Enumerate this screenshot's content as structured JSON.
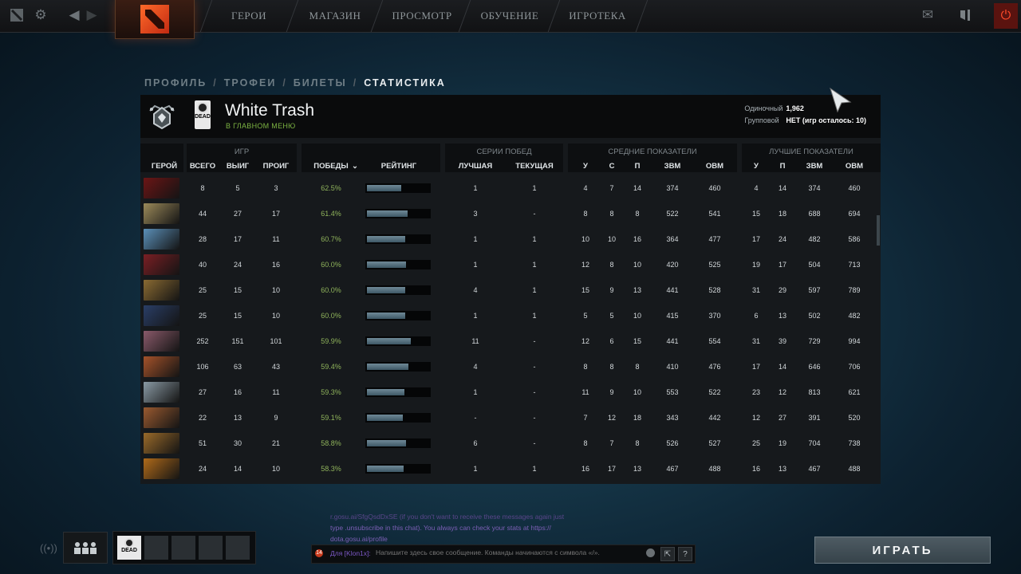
{
  "topbar": {
    "nav": [
      "ГЕРОИ",
      "МАГАЗИН",
      "ПРОСМОТР",
      "ОБУЧЕНИЕ",
      "ИГРОТЕКА"
    ]
  },
  "breadcrumb": [
    "ПРОФИЛЬ",
    "ТРОФЕИ",
    "БИЛЕТЫ",
    "СТАТИСТИКА"
  ],
  "profile": {
    "avatar_text": "DEAD",
    "name": "White Trash",
    "status": "В ГЛАВНОМ МЕНЮ",
    "rank_solo_label": "Одиночный",
    "rank_solo_value": "1,962",
    "rank_party_label": "Групповой",
    "rank_party_value": "НЕТ (игр осталось: 10)"
  },
  "table": {
    "groups": {
      "games": "ИГР",
      "streaks": "СЕРИИ ПОБЕД",
      "avg": "СРЕДНИЕ ПОКАЗАТЕЛИ",
      "best": "ЛУЧШИЕ ПОКАЗАТЕЛИ"
    },
    "headers": {
      "hero": "ГЕРОЙ",
      "total": "ВСЕГО",
      "wins": "ВЫИГ",
      "losses": "ПРОИГ",
      "winrate": "ПОБЕДЫ",
      "rating": "РЕЙТИНГ",
      "best_streak": "ЛУЧШАЯ",
      "cur_streak": "ТЕКУЩАЯ",
      "k": "У",
      "d": "С",
      "a": "П",
      "xpm": "ЗВМ",
      "gpm": "ОВМ",
      "bk": "У",
      "ba": "П",
      "bxpm": "ЗВМ",
      "bgpm": "ОВМ"
    },
    "rows": [
      {
        "hero_color": "#6b1515",
        "total": "8",
        "wins": "5",
        "losses": "3",
        "winrate": "62.5%",
        "rating": 0.55,
        "best": "1",
        "cur": "1",
        "k": "4",
        "d": "7",
        "a": "14",
        "xpm": "374",
        "gpm": "460",
        "bk": "4",
        "ba": "14",
        "bxpm": "374",
        "bgpm": "460"
      },
      {
        "hero_color": "#9c8a5a",
        "total": "44",
        "wins": "27",
        "losses": "17",
        "winrate": "61.4%",
        "rating": 0.66,
        "best": "3",
        "cur": "-",
        "k": "8",
        "d": "8",
        "a": "8",
        "xpm": "522",
        "gpm": "541",
        "bk": "15",
        "ba": "18",
        "bxpm": "688",
        "bgpm": "694"
      },
      {
        "hero_color": "#5b8fb8",
        "total": "28",
        "wins": "17",
        "losses": "11",
        "winrate": "60.7%",
        "rating": 0.61,
        "best": "1",
        "cur": "1",
        "k": "10",
        "d": "10",
        "a": "16",
        "xpm": "364",
        "gpm": "477",
        "bk": "17",
        "ba": "24",
        "bxpm": "482",
        "bgpm": "586"
      },
      {
        "hero_color": "#7a1f24",
        "total": "40",
        "wins": "24",
        "losses": "16",
        "winrate": "60.0%",
        "rating": 0.63,
        "best": "1",
        "cur": "1",
        "k": "12",
        "d": "8",
        "a": "10",
        "xpm": "420",
        "gpm": "525",
        "bk": "19",
        "ba": "17",
        "bxpm": "504",
        "bgpm": "713"
      },
      {
        "hero_color": "#8a6a32",
        "total": "25",
        "wins": "15",
        "losses": "10",
        "winrate": "60.0%",
        "rating": 0.61,
        "best": "4",
        "cur": "1",
        "k": "15",
        "d": "9",
        "a": "13",
        "xpm": "441",
        "gpm": "528",
        "bk": "31",
        "ba": "29",
        "bxpm": "597",
        "bgpm": "789"
      },
      {
        "hero_color": "#2a3e66",
        "total": "25",
        "wins": "15",
        "losses": "10",
        "winrate": "60.0%",
        "rating": 0.61,
        "best": "1",
        "cur": "1",
        "k": "5",
        "d": "5",
        "a": "10",
        "xpm": "415",
        "gpm": "370",
        "bk": "6",
        "ba": "13",
        "bxpm": "502",
        "bgpm": "482"
      },
      {
        "hero_color": "#8a5a6a",
        "total": "252",
        "wins": "151",
        "losses": "101",
        "winrate": "59.9%",
        "rating": 0.71,
        "best": "11",
        "cur": "-",
        "k": "12",
        "d": "6",
        "a": "15",
        "xpm": "441",
        "gpm": "554",
        "bk": "31",
        "ba": "39",
        "bxpm": "729",
        "bgpm": "994"
      },
      {
        "hero_color": "#a4522a",
        "total": "106",
        "wins": "63",
        "losses": "43",
        "winrate": "59.4%",
        "rating": 0.67,
        "best": "4",
        "cur": "-",
        "k": "8",
        "d": "8",
        "a": "8",
        "xpm": "410",
        "gpm": "476",
        "bk": "17",
        "ba": "14",
        "bxpm": "646",
        "bgpm": "706"
      },
      {
        "hero_color": "#8a9aa4",
        "total": "27",
        "wins": "16",
        "losses": "11",
        "winrate": "59.3%",
        "rating": 0.6,
        "best": "1",
        "cur": "-",
        "k": "11",
        "d": "9",
        "a": "10",
        "xpm": "553",
        "gpm": "522",
        "bk": "23",
        "ba": "12",
        "bxpm": "813",
        "bgpm": "621"
      },
      {
        "hero_color": "#9a5a30",
        "total": "22",
        "wins": "13",
        "losses": "9",
        "winrate": "59.1%",
        "rating": 0.58,
        "best": "-",
        "cur": "-",
        "k": "7",
        "d": "12",
        "a": "18",
        "xpm": "343",
        "gpm": "442",
        "bk": "12",
        "ba": "27",
        "bxpm": "391",
        "bgpm": "520"
      },
      {
        "hero_color": "#9a6a2a",
        "total": "51",
        "wins": "30",
        "losses": "21",
        "winrate": "58.8%",
        "rating": 0.63,
        "best": "6",
        "cur": "-",
        "k": "8",
        "d": "7",
        "a": "8",
        "xpm": "526",
        "gpm": "527",
        "bk": "25",
        "ba": "19",
        "bxpm": "704",
        "bgpm": "738"
      },
      {
        "hero_color": "#b06a1a",
        "total": "24",
        "wins": "14",
        "losses": "10",
        "winrate": "58.3%",
        "rating": 0.59,
        "best": "1",
        "cur": "1",
        "k": "16",
        "d": "17",
        "a": "13",
        "xpm": "467",
        "gpm": "488",
        "bk": "16",
        "ba": "13",
        "bxpm": "467",
        "bgpm": "488"
      }
    ]
  },
  "chat": {
    "message_line1": "r.gosu.ai/SfgQsdDxSE (if you don't want to receive these messages again just",
    "message_line2": "type .unsubscribe in this chat). You always can check your stats at https://",
    "message_line3": "dota.gosu.ai/profile",
    "badge": "14",
    "channel_label": "Для [Klon1x]:",
    "input_placeholder": "Напишите здесь свое сообщение. Команды начинаются с символа «/»."
  },
  "party": {
    "avatar_text": "DEAD"
  },
  "play_button": "ИГРАТЬ"
}
